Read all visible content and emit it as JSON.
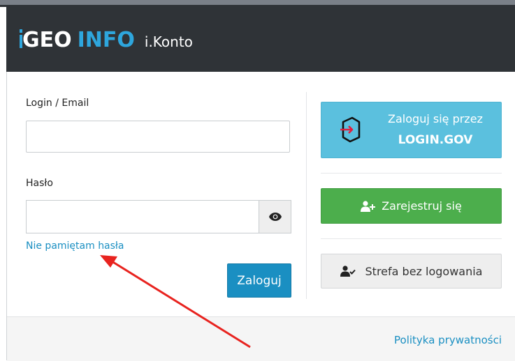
{
  "brand": {
    "geo": "GEO",
    "info": "INFO",
    "product": "i.Konto",
    "accent_color": "#2ea6dd"
  },
  "login_form": {
    "login_label": "Login / Email",
    "login_value": "",
    "password_label": "Hasło",
    "password_value": "",
    "show_password_icon": "eye-icon",
    "forgot_password": "Nie pamiętam hasła",
    "submit_label": "Zaloguj"
  },
  "alternatives": {
    "gov_line1": "Zaloguj się przez",
    "gov_line2": "LOGIN.GOV",
    "gov_icon": "login-gov-icon",
    "register_label": "Zarejestruj się",
    "register_icon": "user-plus-icon",
    "guest_label": "Strefa bez logowania",
    "guest_icon": "user-check-icon"
  },
  "footer": {
    "privacy_link": "Polityka prywatności"
  },
  "colors": {
    "header_bg": "#2f3337",
    "primary": "#1a8fc2",
    "info": "#5bc0de",
    "success": "#4cae4c",
    "annotation_arrow": "#e8231f"
  }
}
